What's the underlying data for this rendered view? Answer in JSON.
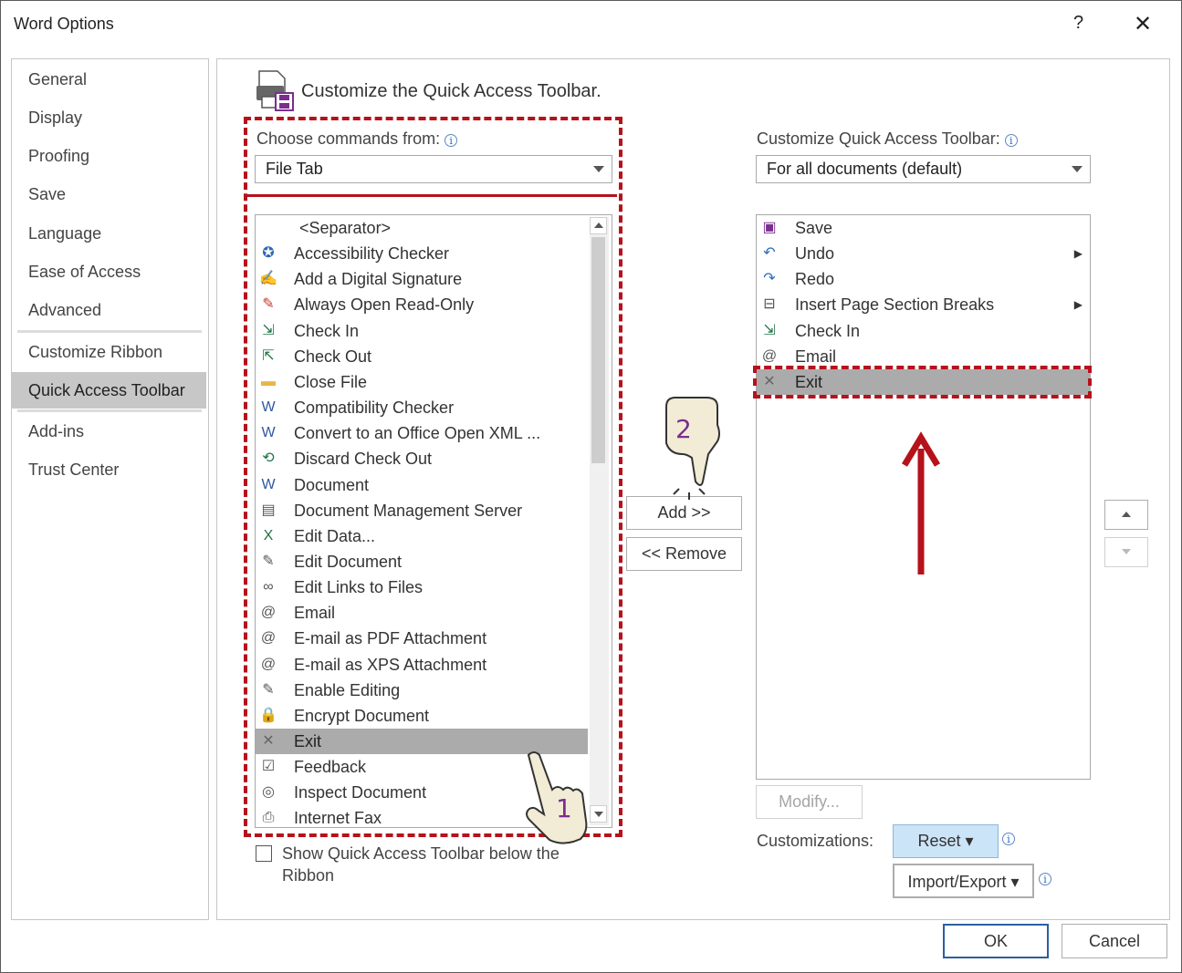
{
  "dialog": {
    "title": "Word Options",
    "help_label": "?",
    "close_label": "✕"
  },
  "sidebar": {
    "items": [
      {
        "label": "General"
      },
      {
        "label": "Display"
      },
      {
        "label": "Proofing"
      },
      {
        "label": "Save"
      },
      {
        "label": "Language"
      },
      {
        "label": "Ease of Access"
      },
      {
        "label": "Advanced"
      },
      {
        "label": "Customize Ribbon"
      },
      {
        "label": "Quick Access Toolbar",
        "selected": true
      },
      {
        "label": "Add-ins"
      },
      {
        "label": "Trust Center"
      }
    ]
  },
  "main": {
    "heading": "Customize the Quick Access Toolbar.",
    "choose_label": "Choose commands from:",
    "choose_value": "File Tab",
    "customize_label": "Customize Quick Access Toolbar:",
    "customize_value": "For all documents (default)",
    "commands": [
      {
        "label": "<Separator>",
        "icon": "separator"
      },
      {
        "label": "Accessibility Checker",
        "icon": "accessibility-icon"
      },
      {
        "label": "Add a Digital Signature",
        "icon": "signature-icon"
      },
      {
        "label": "Always Open Read-Only",
        "icon": "read-only-icon"
      },
      {
        "label": "Check In",
        "icon": "check-in-icon"
      },
      {
        "label": "Check Out",
        "icon": "check-out-icon"
      },
      {
        "label": "Close File",
        "icon": "folder-icon"
      },
      {
        "label": "Compatibility Checker",
        "icon": "compatibility-icon"
      },
      {
        "label": "Convert to an Office Open XML ...",
        "icon": "convert-icon"
      },
      {
        "label": "Discard Check Out",
        "icon": "discard-icon"
      },
      {
        "label": "Document",
        "icon": "word-doc-icon"
      },
      {
        "label": "Document Management Server",
        "icon": "server-icon"
      },
      {
        "label": "Edit Data...",
        "icon": "excel-data-icon"
      },
      {
        "label": "Edit Document",
        "icon": "edit-doc-icon"
      },
      {
        "label": "Edit Links to Files",
        "icon": "links-icon"
      },
      {
        "label": "Email",
        "icon": "email-icon"
      },
      {
        "label": "E-mail as PDF Attachment",
        "icon": "pdf-attach-icon"
      },
      {
        "label": "E-mail as XPS Attachment",
        "icon": "xps-attach-icon"
      },
      {
        "label": "Enable Editing",
        "icon": "enable-edit-icon"
      },
      {
        "label": "Encrypt Document",
        "icon": "lock-icon"
      },
      {
        "label": "Exit",
        "icon": "exit-icon",
        "selected": true
      },
      {
        "label": "Feedback",
        "icon": "feedback-icon"
      },
      {
        "label": "Inspect Document",
        "icon": "inspect-icon"
      },
      {
        "label": "Internet Fax",
        "icon": "fax-icon"
      }
    ],
    "toolbar_items": [
      {
        "label": "Save",
        "icon": "save-icon"
      },
      {
        "label": "Undo",
        "icon": "undo-icon",
        "submenu": true
      },
      {
        "label": "Redo",
        "icon": "redo-icon"
      },
      {
        "label": "Insert Page  Section Breaks",
        "icon": "page-break-icon",
        "submenu": true
      },
      {
        "label": "Check In",
        "icon": "check-in-icon"
      },
      {
        "label": "Email",
        "icon": "email-icon"
      },
      {
        "label": "Exit",
        "icon": "exit-icon",
        "selected": true
      }
    ],
    "add_label": "Add >>",
    "remove_label": "<< Remove",
    "modify_label": "Modify...",
    "customizations_label": "Customizations:",
    "reset_label": "Reset",
    "import_export_label": "Import/Export",
    "show_below_label_1": "Show Quick Access Toolbar below the",
    "show_below_label_2": "Ribbon",
    "show_below_checked": false
  },
  "footer": {
    "ok_label": "OK",
    "cancel_label": "Cancel"
  },
  "annotations": {
    "step1": "1",
    "step2": "2",
    "accent_color": "#b5121b"
  }
}
